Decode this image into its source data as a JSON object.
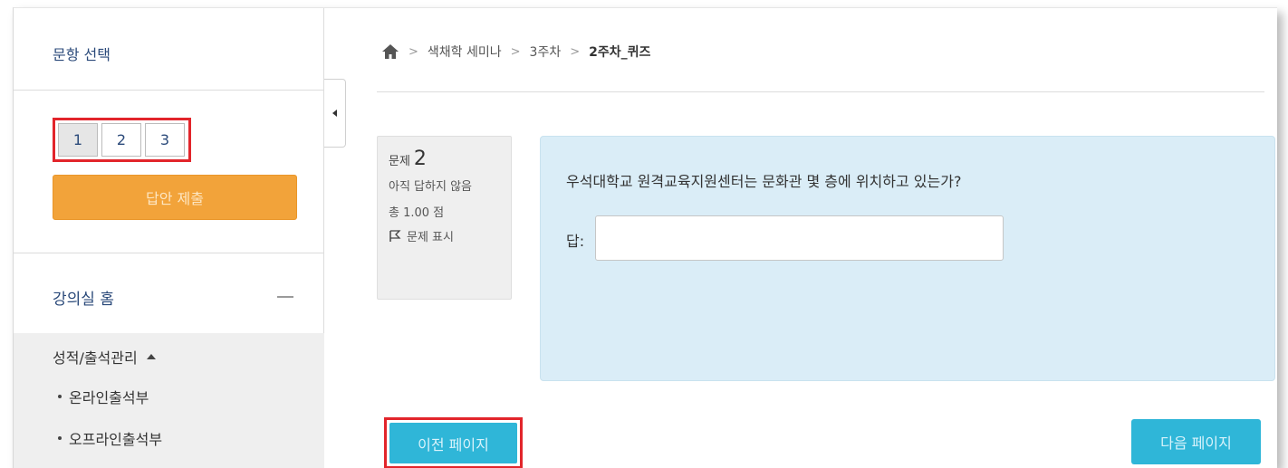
{
  "sidebar": {
    "title": "문항 선택",
    "question_numbers": [
      "1",
      "2",
      "3"
    ],
    "submit_label": "답안 제출",
    "home_label": "강의실 홈",
    "menu": {
      "heading": "성적/출석관리",
      "items": [
        "온라인출석부",
        "오프라인출석부"
      ]
    }
  },
  "breadcrumb": {
    "items": [
      "색채학 세미나",
      "3주차",
      "2주차_퀴즈"
    ]
  },
  "question_info": {
    "number_label": "문제",
    "number": "2",
    "state": "아직 답하지 않음",
    "mark": "총 1.00 점",
    "flag_label": "문제 표시"
  },
  "question": {
    "text": "우석대학교 원격교육지원센터는 문화관 몇 층에 위치하고 있는가?",
    "answer_label": "답:",
    "answer_value": ""
  },
  "navigation": {
    "prev_label": "이전 페이지",
    "next_label": "다음 페이지"
  },
  "colors": {
    "highlight_box": "#e2252b",
    "submit_button": "#f2a33a",
    "nav_button": "#2fb6d8",
    "question_background": "#daedf7"
  }
}
